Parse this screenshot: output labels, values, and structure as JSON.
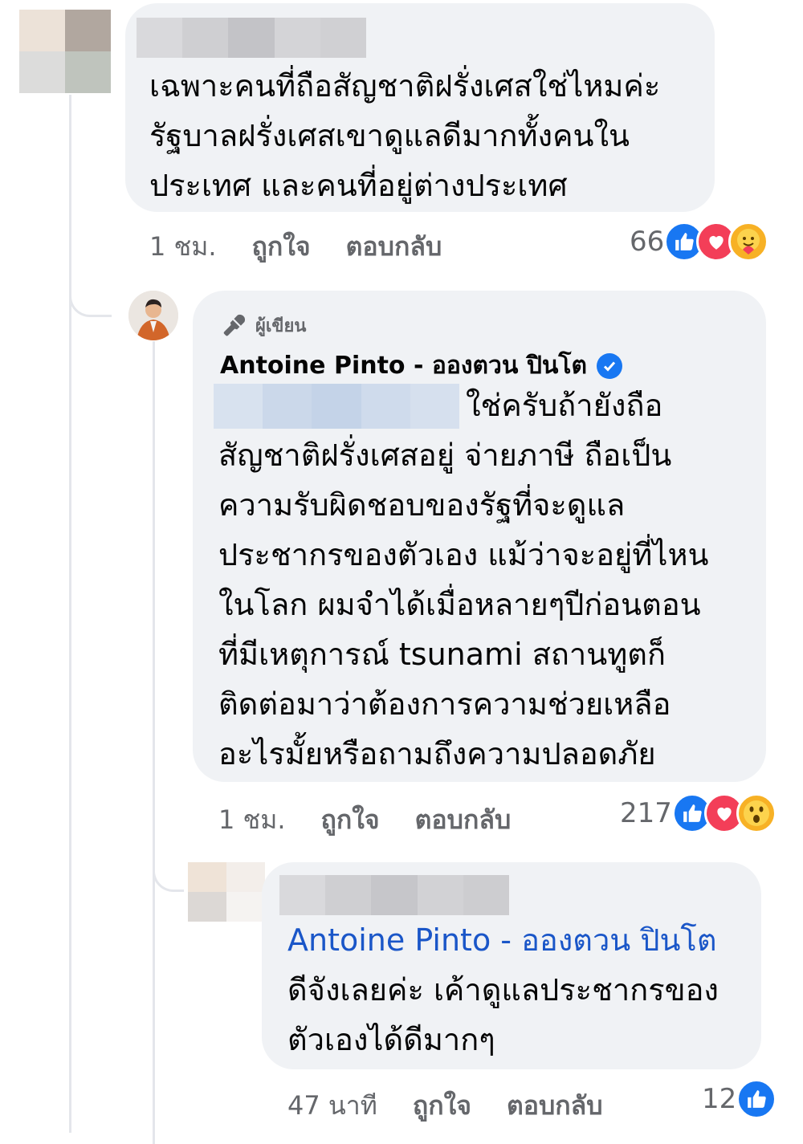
{
  "comments": [
    {
      "text": "เฉพาะคนที่ถือสัญชาติฝรั่งเศสใช่ไหมค่ะ\nรัฐบาลฝรั่งเศสเขาดูแลดีมากทั้งคนใน\nประเทศ และคนที่อยู่ต่างประเทศ",
      "time": "1 ชม.",
      "like_label": "ถูกใจ",
      "reply_label": "ตอบกลับ",
      "reaction_count": "66",
      "reactions": [
        "like-icon",
        "love-icon",
        "care-icon"
      ]
    },
    {
      "author_badge": "ผู้เขียน",
      "author": "Antoine Pinto - อองตวน ปินโต",
      "text_first": "ใช่ครับถ้ายังถือ",
      "text": "สัญชาติฝรั่งเศสอยู่ จ่ายภาษี ถือเป็น\nความรับผิดชอบของรัฐที่จะดูแล\nประชากรของตัวเอง แม้ว่าจะอยู่ที่ไหน\nในโลก ผมจำได้เมื่อหลายๆปีก่อนตอน\nที่มีเหตุการณ์ tsunami สถานทูตก็\nติดต่อมาว่าต้องการความช่วยเหลือ\nอะไรมั้ยหรือถามถึงความปลอดภัย",
      "time": "1 ชม.",
      "like_label": "ถูกใจ",
      "reply_label": "ตอบกลับ",
      "reaction_count": "217",
      "reactions": [
        "like-icon",
        "love-icon",
        "wow-icon"
      ]
    },
    {
      "mention": "Antoine Pinto - อองตวน ปินโต",
      "text": "ดีจังเลยค่ะ เค้าดูแลประชากรของ\nตัวเองได้ดีมากๆ",
      "time": "47 นาที",
      "like_label": "ถูกใจ",
      "reply_label": "ตอบกลับ",
      "reaction_count": "12",
      "reactions": [
        "like-icon"
      ]
    }
  ],
  "colors": {
    "bubble": "#f0f2f5",
    "meta_text": "#65676b",
    "like_blue": "#1877f2",
    "love_red": "#f33e58",
    "mention_blue": "#1a56c8"
  }
}
